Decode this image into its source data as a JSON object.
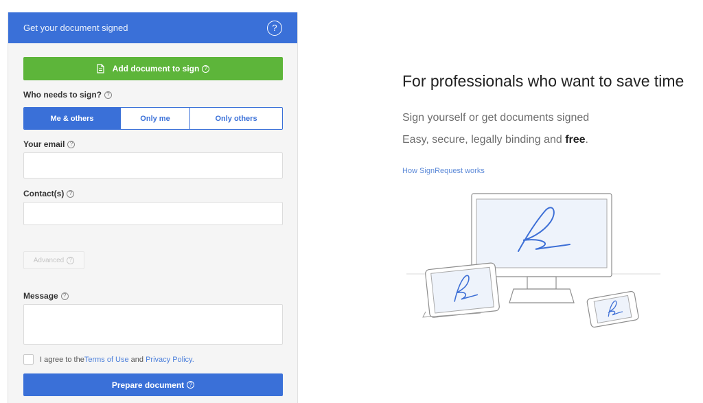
{
  "form": {
    "header_title": "Get your document signed",
    "help_icon": "?",
    "add_document_label": "Add document to sign",
    "who_label": "Who needs to sign?",
    "signer_options": [
      "Me & others",
      "Only me",
      "Only others"
    ],
    "selected_signer_option": "Me & others",
    "email_label": "Your email",
    "email_value": "",
    "contacts_label": "Contact(s)",
    "contacts_value": "",
    "advanced_label": "Advanced",
    "message_label": "Message",
    "message_value": "",
    "agree_prefix": "I agree to the ",
    "terms_link": "Terms of Use",
    "agree_middle": " and ",
    "privacy_link": "Privacy Policy.",
    "prepare_label": "Prepare document",
    "qmark": "?"
  },
  "hero": {
    "title": "For professionals who want to save time",
    "subtitle_line1": "Sign yourself or get documents signed",
    "subtitle_line2_prefix": "Easy, secure, legally binding and ",
    "subtitle_line2_bold": "free",
    "subtitle_line2_suffix": ".",
    "how_link": "How SignRequest works"
  },
  "colors": {
    "primary_blue": "#3a70d8",
    "green": "#5db53a",
    "signature_blue": "#3d6fd6"
  },
  "icons": {
    "help": "help-circle-icon",
    "document": "document-icon",
    "illustration": "devices-signature-illustration"
  }
}
